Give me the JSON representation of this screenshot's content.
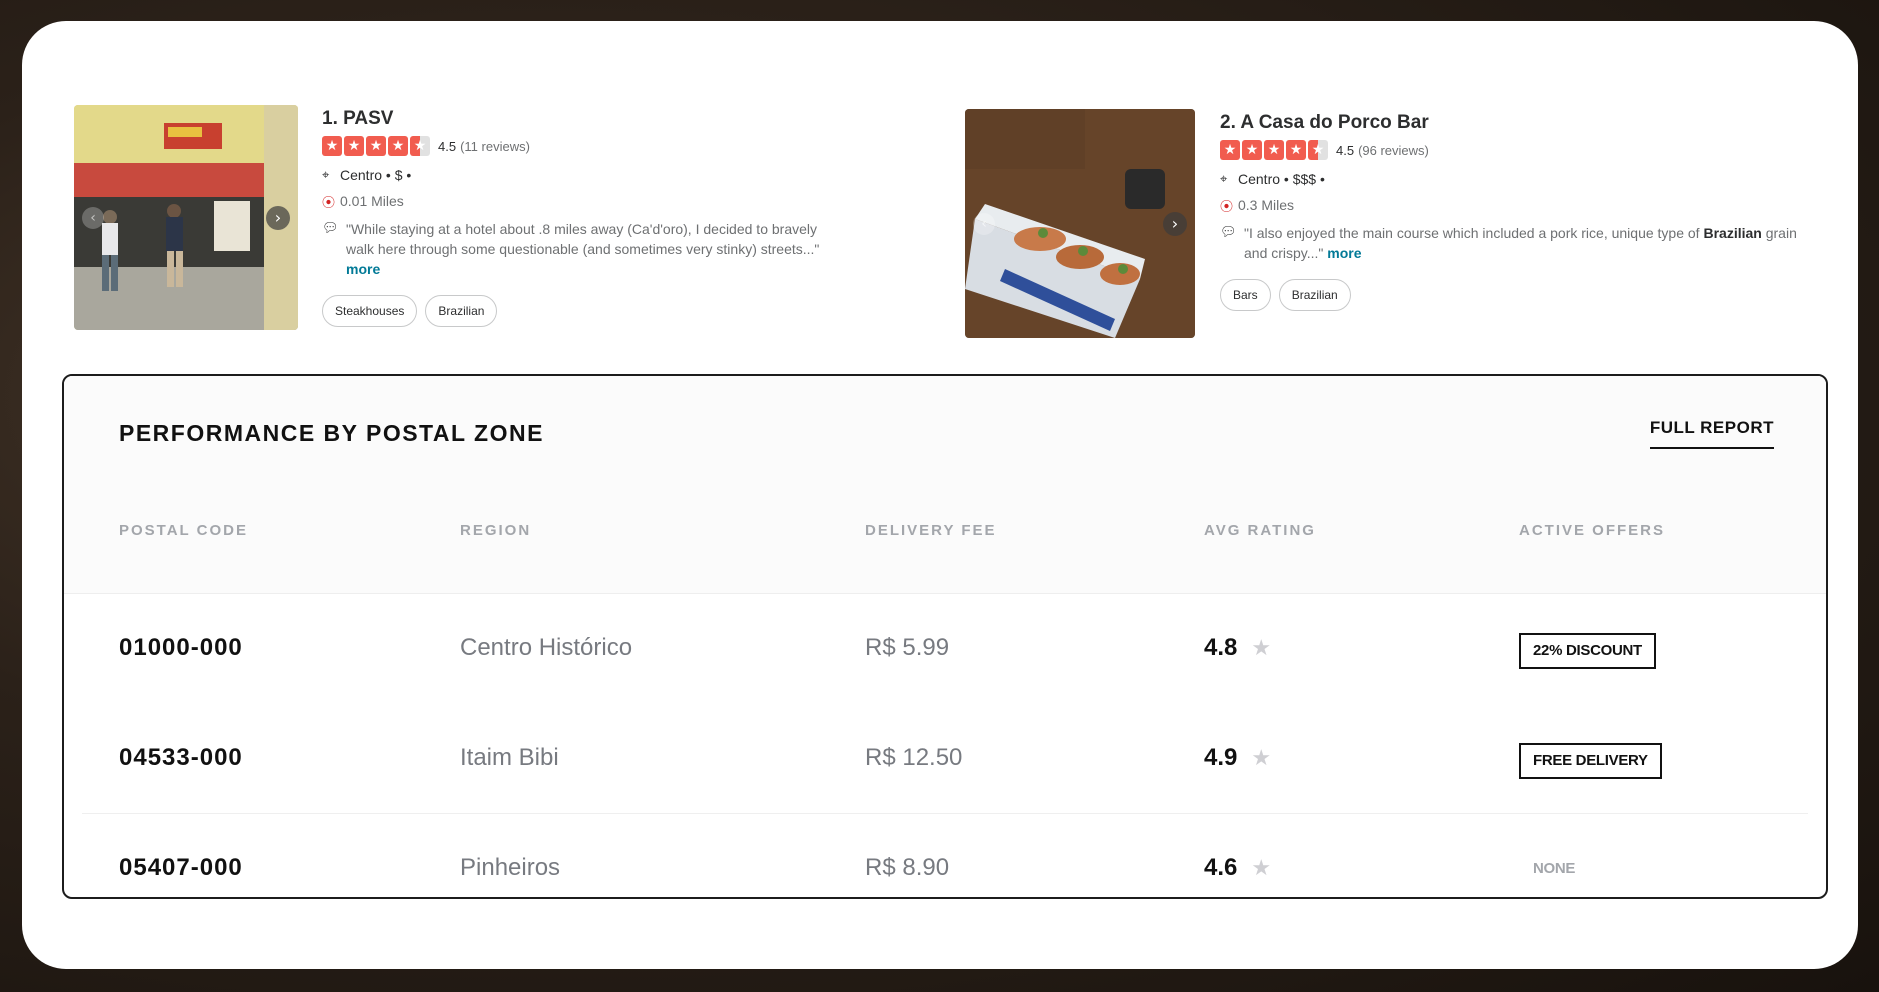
{
  "listings": [
    {
      "name": "1. PASV",
      "rating": "4.5",
      "rating_value": 4.5,
      "reviews": "(11 reviews)",
      "meta": "Centro • $ •",
      "distance": "0.01 Miles",
      "snippet": "\"While staying at a hotel about .8 miles away (Ca'd'oro), I decided to bravely walk here through some questionable (and sometimes very stinky) streets...\"",
      "more": "more",
      "tags": [
        "Steakhouses",
        "Brazilian"
      ]
    },
    {
      "name": "2. A Casa do Porco Bar",
      "rating": "4.5",
      "rating_value": 4.5,
      "reviews": "(96 reviews)",
      "meta": "Centro • $$$ •",
      "distance": "0.3 Miles",
      "snippet_pre": "\"I also enjoyed the main course which included a pork rice, unique type of ",
      "snippet_bold": "Brazilian",
      "snippet_post": " grain and crispy...\"",
      "more": "more",
      "tags": [
        "Bars",
        "Brazilian"
      ]
    }
  ],
  "panel": {
    "title": "PERFORMANCE BY POSTAL ZONE",
    "full_report": "FULL REPORT",
    "columns": [
      "POSTAL CODE",
      "REGION",
      "DELIVERY FEE",
      "AVG RATING",
      "ACTIVE OFFERS"
    ],
    "rows": [
      {
        "code": "01000-000",
        "region": "Centro Histórico",
        "fee": "R$ 5.99",
        "rating": "4.8",
        "offer": "22% DISCOUNT",
        "offer_active": true
      },
      {
        "code": "04533-000",
        "region": "Itaim Bibi",
        "fee": "R$ 12.50",
        "rating": "4.9",
        "offer": "FREE DELIVERY",
        "offer_active": true
      },
      {
        "code": "05407-000",
        "region": "Pinheiros",
        "fee": "R$ 8.90",
        "rating": "4.6",
        "offer": "NONE",
        "offer_active": false
      }
    ]
  },
  "colors": {
    "star_red": "#f15c4f",
    "link_teal": "#027a97",
    "pin_red": "#d32323",
    "header_gray": "#a3a6ab"
  },
  "icons": {
    "star": "star-icon",
    "location": "location-pin-icon",
    "distance": "distance-pin-icon",
    "comment": "speech-bubble-icon",
    "photo_next": "chevron-right-icon",
    "photo_prev": "chevron-left-icon",
    "rating_star": "star-icon"
  }
}
